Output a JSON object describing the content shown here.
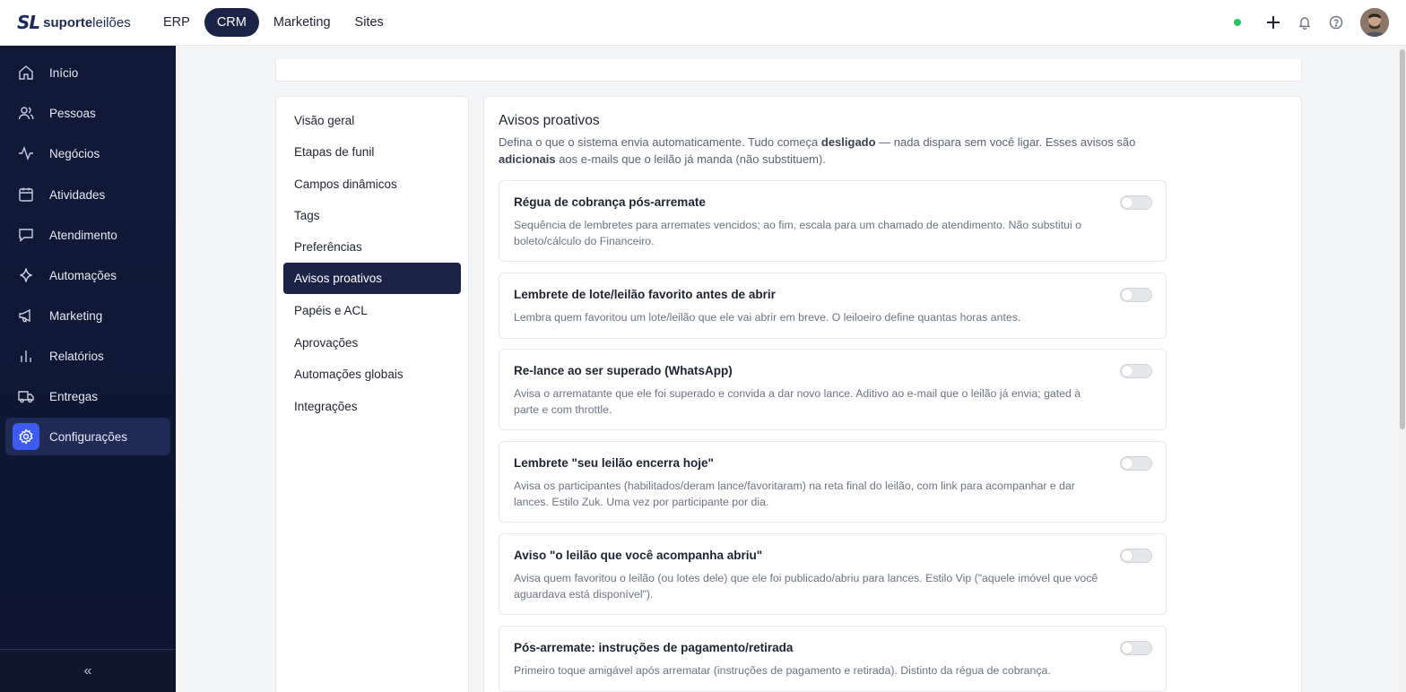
{
  "brand": {
    "mark": "SL",
    "name_bold": "suporte",
    "name_light": "leilões"
  },
  "topnav": {
    "tabs": [
      "ERP",
      "CRM",
      "Marketing",
      "Sites"
    ],
    "active": "CRM"
  },
  "sidebar": {
    "items": [
      {
        "label": "Início",
        "icon": "home-icon"
      },
      {
        "label": "Pessoas",
        "icon": "users-icon"
      },
      {
        "label": "Negócios",
        "icon": "activity-icon"
      },
      {
        "label": "Atividades",
        "icon": "calendar-icon"
      },
      {
        "label": "Atendimento",
        "icon": "chat-icon"
      },
      {
        "label": "Automações",
        "icon": "sparkle-icon"
      },
      {
        "label": "Marketing",
        "icon": "megaphone-icon"
      },
      {
        "label": "Relatórios",
        "icon": "bar-chart-icon"
      },
      {
        "label": "Entregas",
        "icon": "truck-icon"
      },
      {
        "label": "Configurações",
        "icon": "gear-icon"
      }
    ],
    "active": "Configurações",
    "collapse_glyph": "«"
  },
  "settings_nav": {
    "items": [
      "Visão geral",
      "Etapas de funil",
      "Campos dinâmicos",
      "Tags",
      "Preferências",
      "Avisos proativos",
      "Papéis e ACL",
      "Aprovações",
      "Automações globais",
      "Integrações"
    ],
    "active": "Avisos proativos"
  },
  "panel": {
    "title": "Avisos proativos",
    "desc_1": "Defina o que o sistema envia automaticamente. Tudo começa ",
    "desc_bold_1": "desligado",
    "desc_2": " — nada dispara sem você ligar. Esses avisos são ",
    "desc_bold_2": "adicionais",
    "desc_3": " aos e-mails que o leilão já manda (não substituem)."
  },
  "cards": [
    {
      "title": "Régua de cobrança pós-arremate",
      "desc": "Sequência de lembretes para arremates vencidos; ao fim, escala para um chamado de atendimento. Não substitui o boleto/cálculo do Financeiro.",
      "enabled": false
    },
    {
      "title": "Lembrete de lote/leilão favorito antes de abrir",
      "desc": "Lembra quem favoritou um lote/leilão que ele vai abrir em breve. O leiloeiro define quantas horas antes.",
      "enabled": false
    },
    {
      "title": "Re-lance ao ser superado (WhatsApp)",
      "desc": "Avisa o arrematante que ele foi superado e convida a dar novo lance. Aditivo ao e-mail que o leilão já envia; gated à parte e com throttle.",
      "enabled": false
    },
    {
      "title": "Lembrete \"seu leilão encerra hoje\"",
      "desc": "Avisa os participantes (habilitados/deram lance/favoritaram) na reta final do leilão, com link para acompanhar e dar lances. Estilo Zuk. Uma vez por participante por dia.",
      "enabled": false
    },
    {
      "title": "Aviso \"o leilão que você acompanha abriu\"",
      "desc": "Avisa quem favoritou o leilão (ou lotes dele) que ele foi publicado/abriu para lances. Estilo Vip (\"aquele imóvel que você aguardava está disponível\").",
      "enabled": false
    },
    {
      "title": "Pós-arremate: instruções de pagamento/retirada",
      "desc": "Primeiro toque amigável após arrematar (instruções de pagamento e retirada). Distinto da régua de cobrança.",
      "enabled": false
    }
  ],
  "colors": {
    "navy": "#1b2347",
    "sidebar": "#101a37",
    "accent": "#3d5af1",
    "online": "#22c55e"
  }
}
